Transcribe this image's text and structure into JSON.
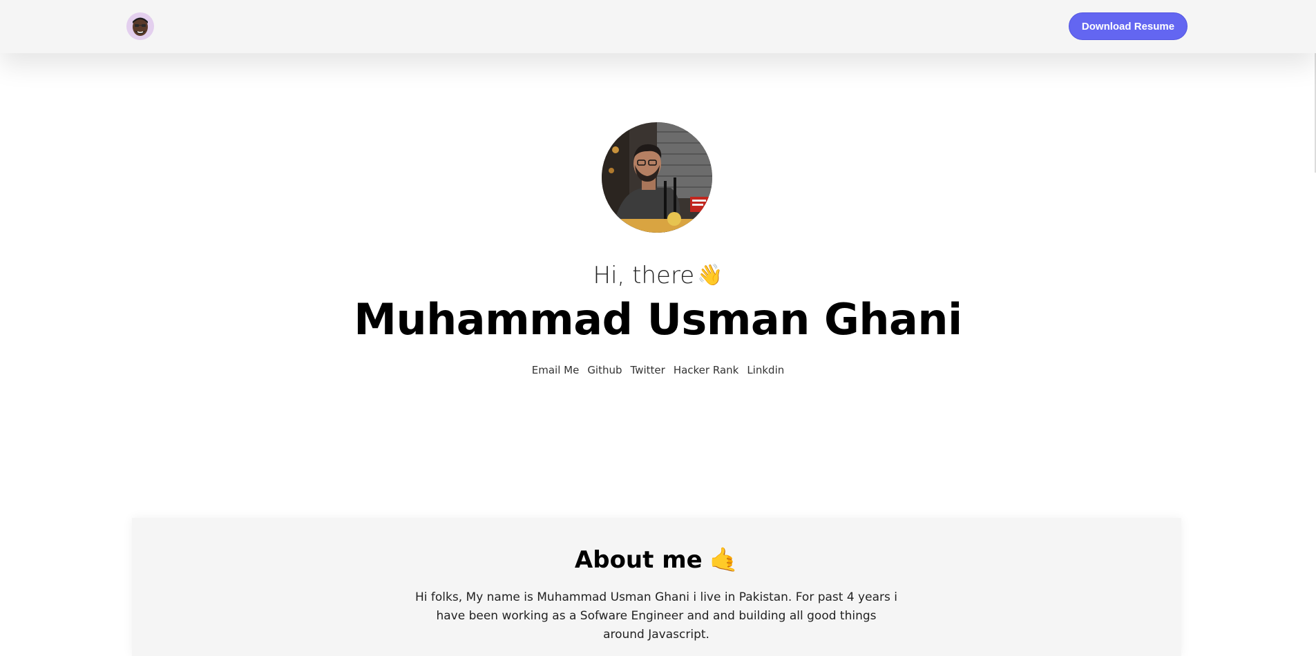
{
  "navbar": {
    "avatar_icon": "memoji-avatar-icon",
    "download_button_label": "Download Resume",
    "accent_color": "#6366f1"
  },
  "hero": {
    "profile_photo": "profile-photo",
    "greeting": "Hi, there",
    "greeting_emoji": "👋",
    "name": "Muhammad Usman Ghani",
    "links": [
      "Email Me",
      "Github",
      "Twitter",
      "Hacker Rank",
      "Linkdin"
    ]
  },
  "about": {
    "title": "About me",
    "title_emoji": "🤙",
    "text": "Hi folks, My name is Muhammad Usman Ghani i live in Pakistan. For past 4 years i have been working as a Sofware Engineer and and building all good things around Javascript."
  }
}
